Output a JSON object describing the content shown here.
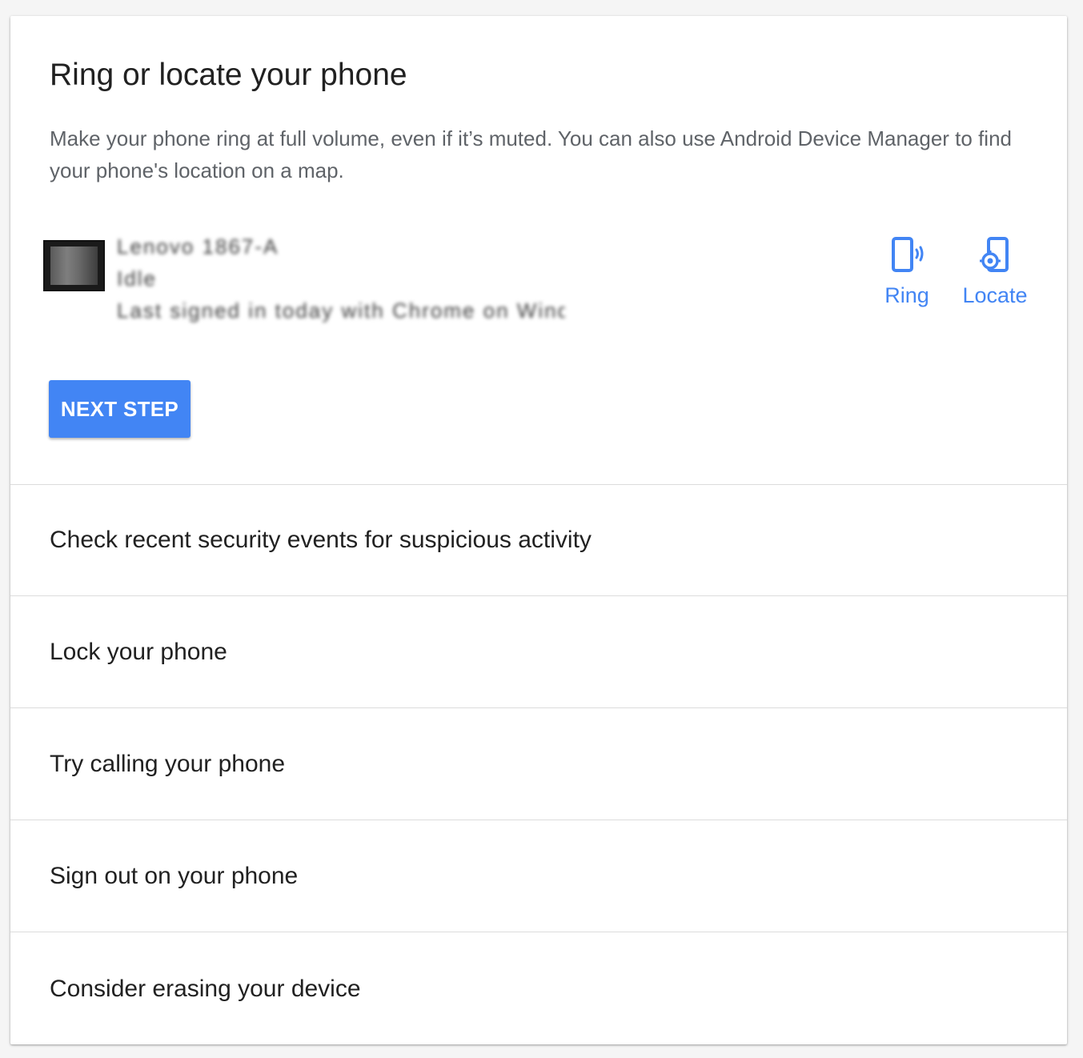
{
  "current_step": {
    "title": "Ring or locate your phone",
    "description": "Make your phone ring at full volume, even if it’s muted. You can also use Android Device Manager to find your phone's location on a map.",
    "device": {
      "name": "Lenovo 1867-A",
      "status": "Idle",
      "last_seen": "Last signed in today with Chrome on Windows"
    },
    "actions": [
      {
        "label": "Ring",
        "icon": "phone-ring-icon"
      },
      {
        "label": "Locate",
        "icon": "phone-locate-icon"
      }
    ],
    "next_button_label": "NEXT STEP"
  },
  "steps": [
    {
      "label": "Check recent security events for suspicious activity"
    },
    {
      "label": "Lock your phone"
    },
    {
      "label": "Try calling your phone"
    },
    {
      "label": "Sign out on your phone"
    },
    {
      "label": "Consider erasing your device"
    }
  ],
  "colors": {
    "accent": "#4285f4",
    "text_primary": "#212121",
    "text_secondary": "#5f6368",
    "divider": "#dcdcdc",
    "background": "#f5f5f5"
  }
}
